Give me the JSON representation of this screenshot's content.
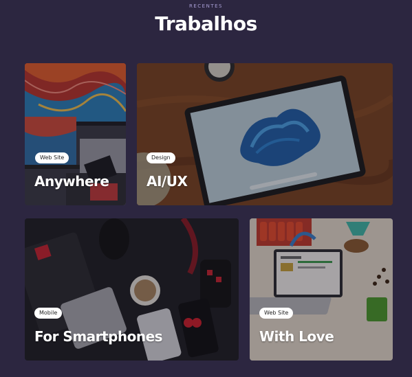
{
  "section": {
    "eyebrow": "RECENTES",
    "title": "Trabalhos"
  },
  "projects": [
    {
      "category": "Web Site",
      "title": "Anywhere"
    },
    {
      "category": "Design",
      "title": "AI/UX"
    },
    {
      "category": "Mobile",
      "title": "For Smartphones"
    },
    {
      "category": "Web Site",
      "title": "With Love"
    }
  ]
}
